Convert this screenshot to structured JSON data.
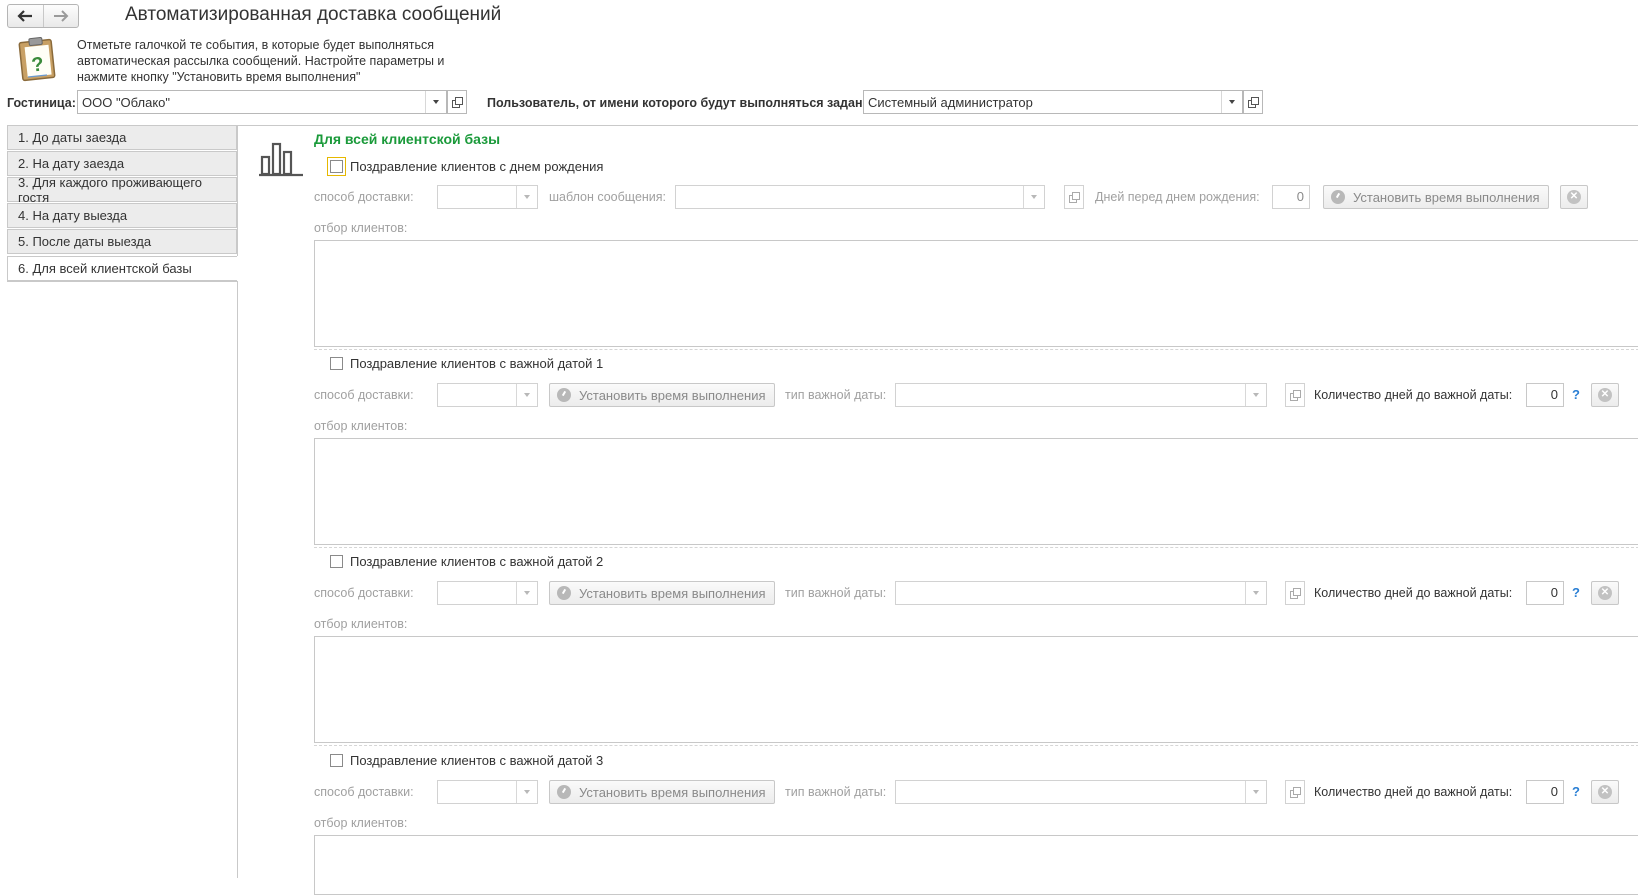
{
  "window": {
    "title": "Автоматизированная доставка сообщений",
    "hint": "Отметьте галочкой те события, в которые будет выполняться автоматическая рассылка сообщений. Настройте параметры и нажмите кнопку \"Установить время выполнения\""
  },
  "top": {
    "hotel_label": "Гостиница:",
    "hotel_value": "ООО \"Облако\"",
    "user_label": "Пользователь, от имени которого будут выполняться задания:",
    "user_value": "Системный администратор"
  },
  "tabs": [
    {
      "label": "1. До даты заезда"
    },
    {
      "label": "2. На дату заезда"
    },
    {
      "label": "3. Для каждого проживающего гостя"
    },
    {
      "label": "4. На дату выезда"
    },
    {
      "label": "5. После даты выезда"
    },
    {
      "label": "6. Для всей клиентской базы"
    }
  ],
  "main": {
    "section_title": "Для всей клиентской базы",
    "birthday": {
      "checkbox_label": "Поздравление клиентов с днем рождения",
      "delivery_label": "способ доставки:",
      "template_label": "шаблон сообщения:",
      "days_label": "Дней перед днем рождения:",
      "days_value": "0",
      "set_time_label": "Установить время выполнения",
      "filter_label": "отбор клиентов:"
    },
    "important_dates": [
      {
        "checkbox_label": "Поздравление клиентов с важной датой 1",
        "delivery_label": "способ доставки:",
        "set_time_label": "Установить время выполнения",
        "date_type_label": "тип важной даты:",
        "days_label": "Количество дней до важной даты:",
        "days_value": "0",
        "help": "?",
        "filter_label": "отбор клиентов:"
      },
      {
        "checkbox_label": "Поздравление клиентов с важной датой 2",
        "delivery_label": "способ доставки:",
        "set_time_label": "Установить время выполнения",
        "date_type_label": "тип важной даты:",
        "days_label": "Количество дней до важной даты:",
        "days_value": "0",
        "help": "?",
        "filter_label": "отбор клиентов:"
      },
      {
        "checkbox_label": "Поздравление клиентов с важной датой 3",
        "delivery_label": "способ доставки:",
        "set_time_label": "Установить время выполнения",
        "date_type_label": "тип важной даты:",
        "days_label": "Количество дней до важной даты:",
        "days_value": "0",
        "help": "?",
        "filter_label": "отбор клиентов:"
      }
    ]
  },
  "icons": {
    "back": "arrow-left-icon",
    "forward": "arrow-right-icon",
    "clipboard": "clipboard-question-icon",
    "section": "bar-chart-icon",
    "clock": "clock-icon",
    "clear": "clear-icon",
    "open": "open-form-icon"
  },
  "colors": {
    "section_title": "#1a9a3a",
    "help": "#2a7fd4",
    "focus": "#e6b800"
  }
}
